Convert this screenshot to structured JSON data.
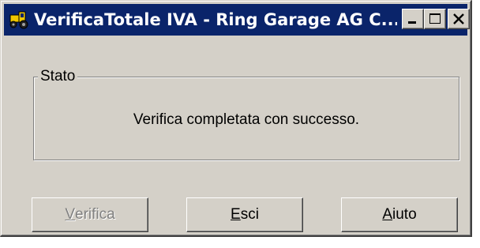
{
  "window": {
    "title": "VerificaTotale IVA - Ring Garage AG C...",
    "app_icon": "tractor-icon",
    "controls": {
      "minimize_icon": "minimize-icon",
      "maximize_icon": "maximize-icon",
      "close_icon": "close-icon"
    }
  },
  "status_group": {
    "label": "Stato",
    "message": "Verifica completata con successo."
  },
  "buttons": {
    "verify": {
      "accel": "V",
      "rest": "erifica",
      "enabled": false
    },
    "exit": {
      "accel": "E",
      "rest": "sci",
      "enabled": true
    },
    "help": {
      "accel": "A",
      "rest": "iuto",
      "enabled": true
    }
  },
  "colors": {
    "titlebar": "#0a246a",
    "face": "#d4d0c8",
    "disabled_text": "#808080"
  }
}
